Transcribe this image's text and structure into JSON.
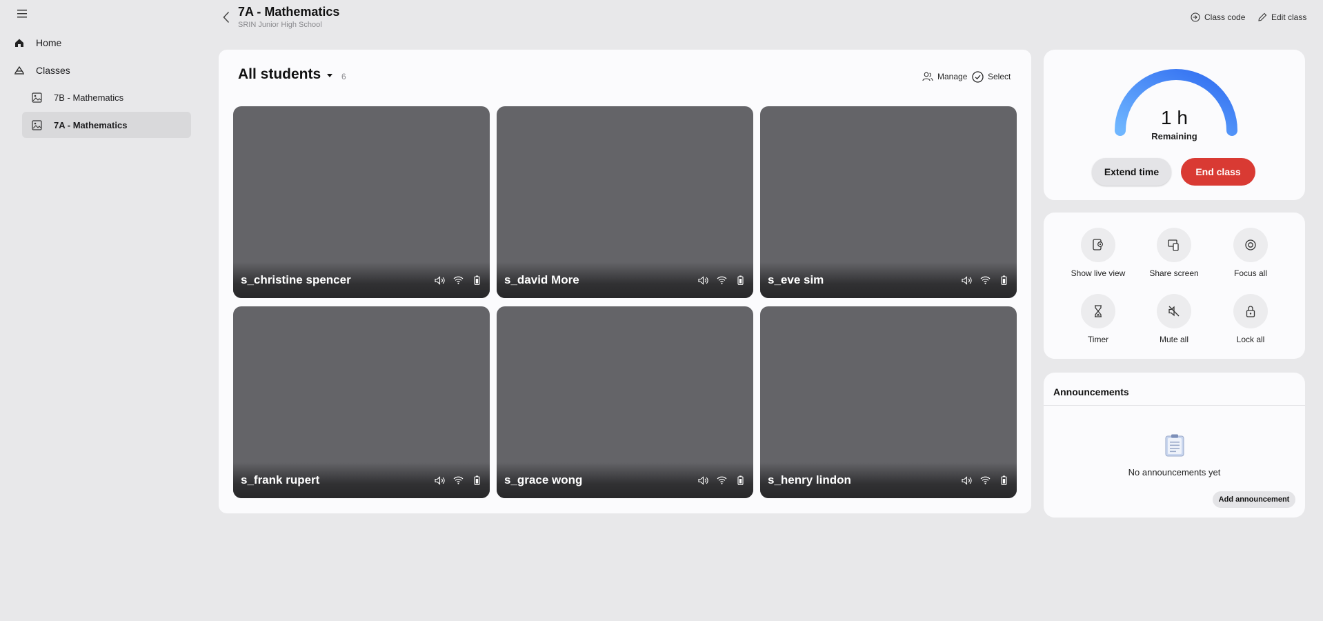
{
  "sidebar": {
    "items": [
      {
        "label": "Home",
        "icon": "home-icon"
      },
      {
        "label": "Classes",
        "icon": "classes-icon"
      }
    ],
    "classes": [
      {
        "label": "7B - Mathematics",
        "icon": "class-image-icon",
        "active": false
      },
      {
        "label": "7A - Mathematics",
        "icon": "class-image-icon",
        "active": true
      }
    ]
  },
  "header": {
    "title": "7A - Mathematics",
    "subtitle": "SRIN Junior High School",
    "actions": {
      "class_code": "Class code",
      "edit_class": "Edit class"
    }
  },
  "main": {
    "students_title": "All students",
    "students_count": "6",
    "manage_label": "Manage",
    "select_label": "Select",
    "students": [
      {
        "name": "s_christine spencer"
      },
      {
        "name": "s_david More"
      },
      {
        "name": "s_eve sim"
      },
      {
        "name": "s_frank rupert"
      },
      {
        "name": "s_grace wong"
      },
      {
        "name": "s_henry lindon"
      }
    ]
  },
  "timer": {
    "value": "1 h",
    "label": "Remaining",
    "extend_label": "Extend time",
    "end_label": "End class"
  },
  "controls": [
    {
      "label": "Show live view",
      "icon": "live-view-icon"
    },
    {
      "label": "Share screen",
      "icon": "share-screen-icon"
    },
    {
      "label": "Focus all",
      "icon": "focus-icon"
    },
    {
      "label": "Timer",
      "icon": "hourglass-icon"
    },
    {
      "label": "Mute all",
      "icon": "mute-icon"
    },
    {
      "label": "Lock all",
      "icon": "lock-icon"
    }
  ],
  "announcements": {
    "title": "Announcements",
    "empty_text": "No announcements yet",
    "add_label": "Add announcement"
  },
  "colors": {
    "background": "#e8e8ea",
    "card": "#fbfbfd",
    "tile": "#646468",
    "end_class": "#d93a33",
    "gauge_gradient_start": "#6fb6ff",
    "gauge_gradient_end": "#2f6bf0"
  }
}
